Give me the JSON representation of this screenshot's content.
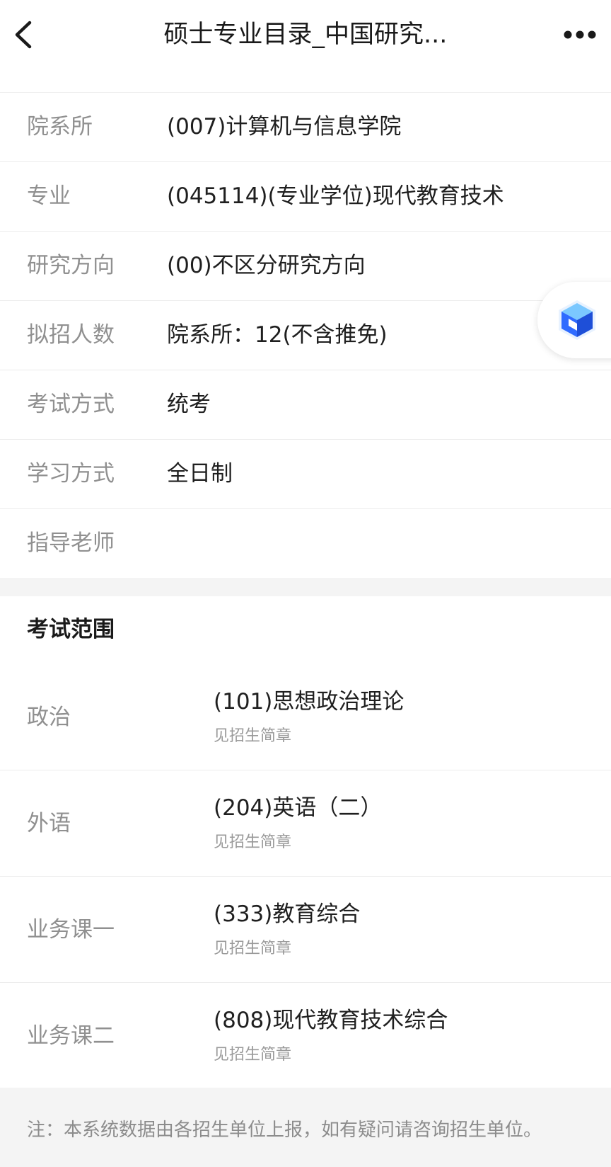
{
  "navbar": {
    "title": "硕士专业目录_中国研究...",
    "back_icon": "back-arrow-icon",
    "more_icon": "more-dots-icon"
  },
  "info": {
    "rows": [
      {
        "label": "院系所",
        "value": "(007)计算机与信息学院"
      },
      {
        "label": "专业",
        "value": "(045114)(专业学位)现代教育技术"
      },
      {
        "label": "研究方向",
        "value": "(00)不区分研究方向"
      },
      {
        "label": "拟招人数",
        "value": "院系所：12(不含推免)"
      },
      {
        "label": "考试方式",
        "value": "统考"
      },
      {
        "label": "学习方式",
        "value": "全日制"
      },
      {
        "label": "指导老师",
        "value": ""
      }
    ]
  },
  "floating_badge": {
    "icon": "cube-logo-icon",
    "color_primary": "#2f6bff",
    "color_secondary": "#7bc8ff"
  },
  "exam_scope": {
    "title": "考试范围",
    "rows": [
      {
        "label": "政治",
        "subject": "(101)思想政治理论",
        "note": "见招生简章"
      },
      {
        "label": "外语",
        "subject": "(204)英语（二）",
        "note": "见招生简章"
      },
      {
        "label": "业务课一",
        "subject": "(333)教育综合",
        "note": "见招生简章"
      },
      {
        "label": "业务课二",
        "subject": "(808)现代教育技术综合",
        "note": "见招生简章"
      }
    ]
  },
  "footer": {
    "note": "注：本系统数据由各招生单位上报，如有疑问请咨询招生单位。"
  }
}
